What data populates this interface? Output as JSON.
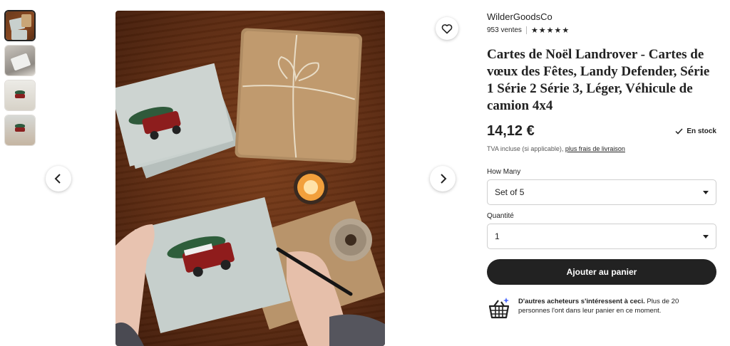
{
  "shop": {
    "name": "WilderGoodsCo",
    "sales": "953 ventes",
    "stars": "★★★★★"
  },
  "product": {
    "title": "Cartes de Noël Landrover - Cartes de vœux des Fêtes, Landy Defender, Série 1 Série 2 Série 3, Léger, Véhicule de camion 4x4",
    "price": "14,12 €",
    "stock": "En stock",
    "tax_text": "TVA incluse (si applicable), ",
    "shipping_link": "plus frais de livraison"
  },
  "options": {
    "how_many_label": "How Many",
    "how_many_value": "Set of 5",
    "quantity_label": "Quantité",
    "quantity_value": "1"
  },
  "actions": {
    "add_to_cart": "Ajouter au panier"
  },
  "notice": {
    "bold": "D'autres acheteurs s'intéressent à ceci.",
    "rest": " Plus de 20 personnes l'ont dans leur panier en ce moment."
  },
  "colors": {
    "button_bg": "#222222",
    "accent_sparkle": "#4d6bfe"
  },
  "icons": [
    "heart-icon",
    "chevron-left-icon",
    "chevron-right-icon",
    "check-icon",
    "basket-icon"
  ]
}
